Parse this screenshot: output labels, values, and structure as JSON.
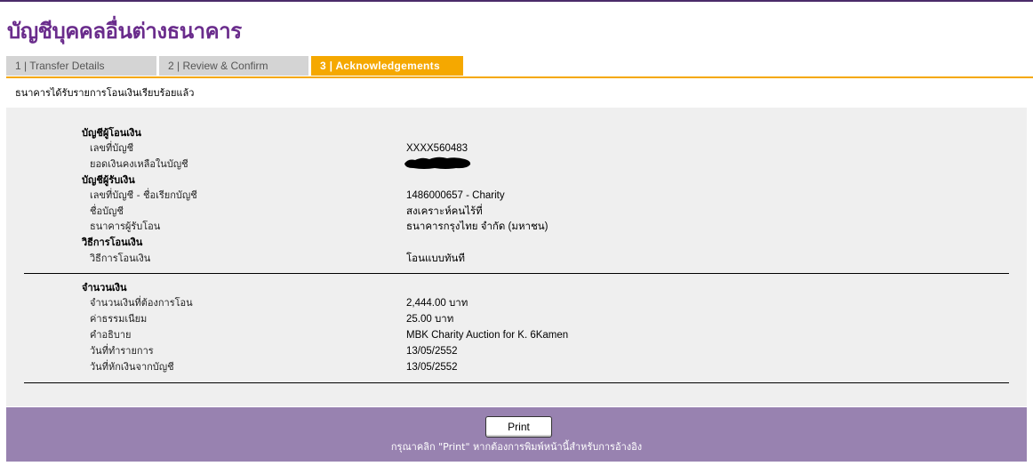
{
  "page": {
    "title": "บัญชีบุคคลอื่นต่างธนาคาร"
  },
  "tabs": [
    {
      "label": "1 | Transfer Details",
      "active": false
    },
    {
      "label": "2 | Review & Confirm",
      "active": false
    },
    {
      "label": "3 | Acknowledgements",
      "active": true
    }
  ],
  "acknowledgement": "ธนาคารได้รับรายการโอนเงินเรียบร้อยแล้ว",
  "from_account": {
    "header": "บัญชีผู้โอนเงิน",
    "account_number_label": "เลขที่บัญชี",
    "account_number_value": "XXXX560483",
    "balance_label": "ยอดเงินคงเหลือในบัญชี"
  },
  "to_account": {
    "header": "บัญชีผู้รับเงิน",
    "account_label": "เลขที่บัญชี - ชื่อเรียกบัญชี",
    "account_value": "1486000657 - Charity",
    "name_label": "ชื่อบัญชี",
    "name_value": "สงเคราะห์คนไร้ที่",
    "bank_label": "ธนาคารผู้รับโอน",
    "bank_value": "ธนาคารกรุงไทย จำกัด (มหาชน)"
  },
  "method": {
    "header": "วิธีการโอนเงิน",
    "label": "วิธีการโอนเงิน",
    "value": "โอนแบบทันที"
  },
  "amount": {
    "header": "จำนวนเงิน",
    "transfer_label": "จำนวนเงินที่ต้องการโอน",
    "transfer_value": "2,444.00 บาท",
    "fee_label": "ค่าธรรมเนียม",
    "fee_value": "25.00  บาท",
    "description_label": "คำอธิบาย",
    "description_value": "MBK Charity Auction for K. 6Kamen",
    "transaction_date_label": "วันที่ทำรายการ",
    "transaction_date_value": "13/05/2552",
    "debit_date_label": "วันที่หักเงินจากบัญชี",
    "debit_date_value": "13/05/2552"
  },
  "footer": {
    "print_label": "Print",
    "print_note": "กรุณาคลิก \"Print\" หากต้องการพิมพ์หน้านี้สำหรับการอ้างอิง"
  },
  "colors": {
    "brand_purple": "#6a2c8c",
    "tab_active": "#f5a800",
    "tab_inactive": "#d4d4d4",
    "panel": "#efefef",
    "footer": "#9882b0"
  }
}
